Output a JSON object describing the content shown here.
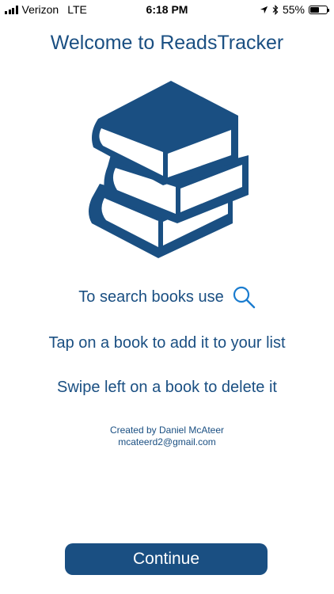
{
  "status_bar": {
    "carrier": "Verizon",
    "network": "LTE",
    "time": "6:18 PM",
    "battery_percent": "55%",
    "battery_level": 0.55
  },
  "welcome": {
    "title": "Welcome to ReadsTracker"
  },
  "instructions": {
    "search": "To search books use",
    "tap": "Tap on a book to add it to your list",
    "swipe": "Swipe left on a book to delete it"
  },
  "credits": {
    "author": "Created by Daniel McAteer",
    "email": "mcateerd2@gmail.com"
  },
  "footer": {
    "continue_label": "Continue"
  },
  "colors": {
    "brand": "#1a4f82",
    "background": "#ffffff"
  },
  "icons": {
    "hero": "books-stack-icon",
    "search": "search-icon"
  }
}
